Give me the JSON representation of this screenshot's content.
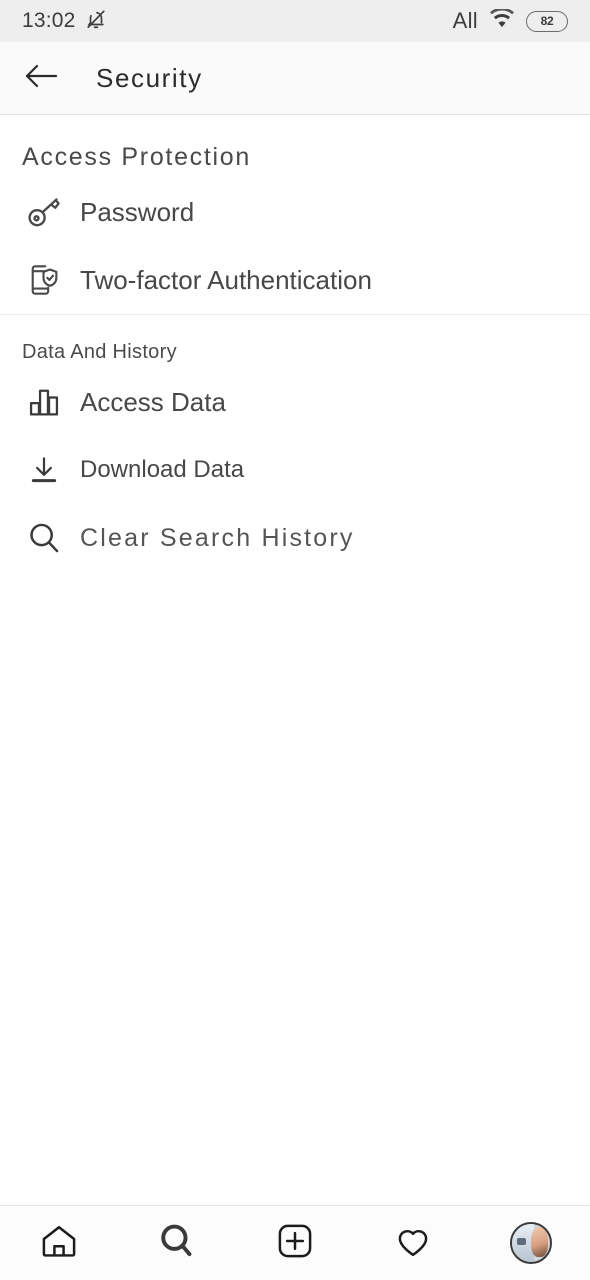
{
  "status_bar": {
    "time": "13:02",
    "mute_icon": "bell-muted-icon",
    "network_label": "All",
    "wifi_icon": "wifi-icon",
    "battery_level": "82"
  },
  "header": {
    "back_icon": "back-arrow-icon",
    "title": "Security"
  },
  "sections": [
    {
      "title": "Access Protection",
      "items": [
        {
          "icon": "key-icon",
          "label": "Password"
        },
        {
          "icon": "phone-shield-icon",
          "label": "Two-factor Authentication"
        }
      ]
    },
    {
      "title": "Data And History",
      "items": [
        {
          "icon": "bar-chart-icon",
          "label": "Access Data"
        },
        {
          "icon": "download-icon",
          "label": "Download Data"
        },
        {
          "icon": "search-icon",
          "label": "Clear Search History"
        }
      ]
    }
  ],
  "bottom_nav": [
    {
      "icon": "home-icon",
      "label": "Home"
    },
    {
      "icon": "search-icon",
      "label": "Search"
    },
    {
      "icon": "plus-square-icon",
      "label": "Create"
    },
    {
      "icon": "heart-icon",
      "label": "Activity"
    },
    {
      "icon": "profile-avatar",
      "label": "Profile"
    }
  ],
  "colors": {
    "status_bar_bg": "#eeeeee",
    "header_bg": "#fafafa",
    "page_bg": "#ffffff",
    "text": "#484848",
    "divider": "#ededed"
  }
}
